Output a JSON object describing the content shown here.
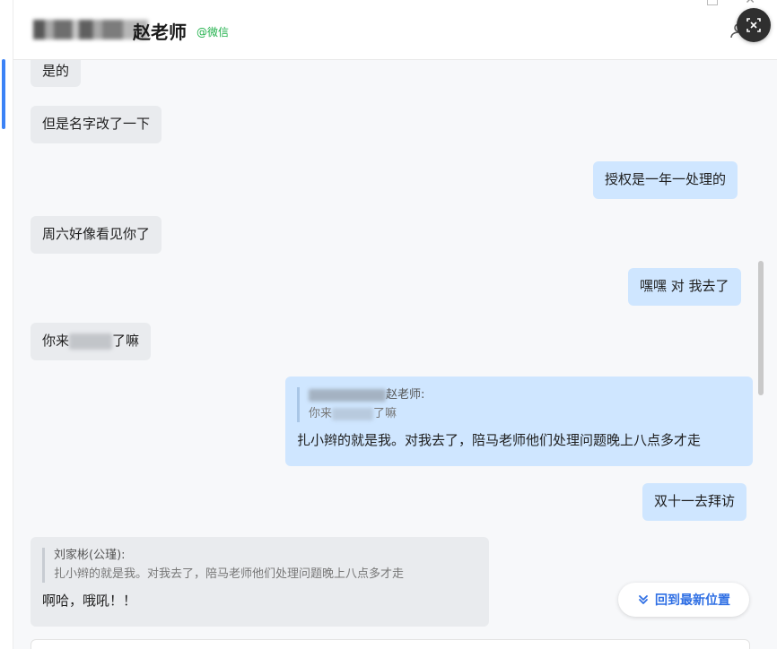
{
  "header": {
    "title": "赵老师",
    "source": "@微信"
  },
  "messages": [
    {
      "dir": "in",
      "text": "是的"
    },
    {
      "dir": "in",
      "text": "但是名字改了一下"
    },
    {
      "dir": "out",
      "text": "授权是一年一处理的"
    },
    {
      "dir": "in",
      "text": "周六好像看见你了"
    },
    {
      "dir": "out",
      "text": "嘿嘿 对 我去了"
    },
    {
      "dir": "in",
      "text_before": "你来",
      "text_after": "了嘛"
    },
    {
      "dir": "out",
      "quote_author": "赵老师:",
      "quote_before": "你来",
      "quote_after": "了嘛",
      "text": "扎小辫的就是我。对我去了，陪马老师他们处理问题晚上八点多才走"
    },
    {
      "dir": "out",
      "text": "双十一去拜访"
    },
    {
      "dir": "in",
      "quote_author": "刘家彬(公瑾):",
      "quote_text": "扎小辫的就是我。对我去了，陪马老师他们处理问题晚上八点多才走",
      "text": "啊哈，哦吼！！"
    }
  ],
  "jump_button": {
    "label": "回到最新位置"
  },
  "colors": {
    "incoming": "#e9ebee",
    "outgoing": "#cfe6ff",
    "accent": "#2f6fe4",
    "source": "#22b14c"
  }
}
